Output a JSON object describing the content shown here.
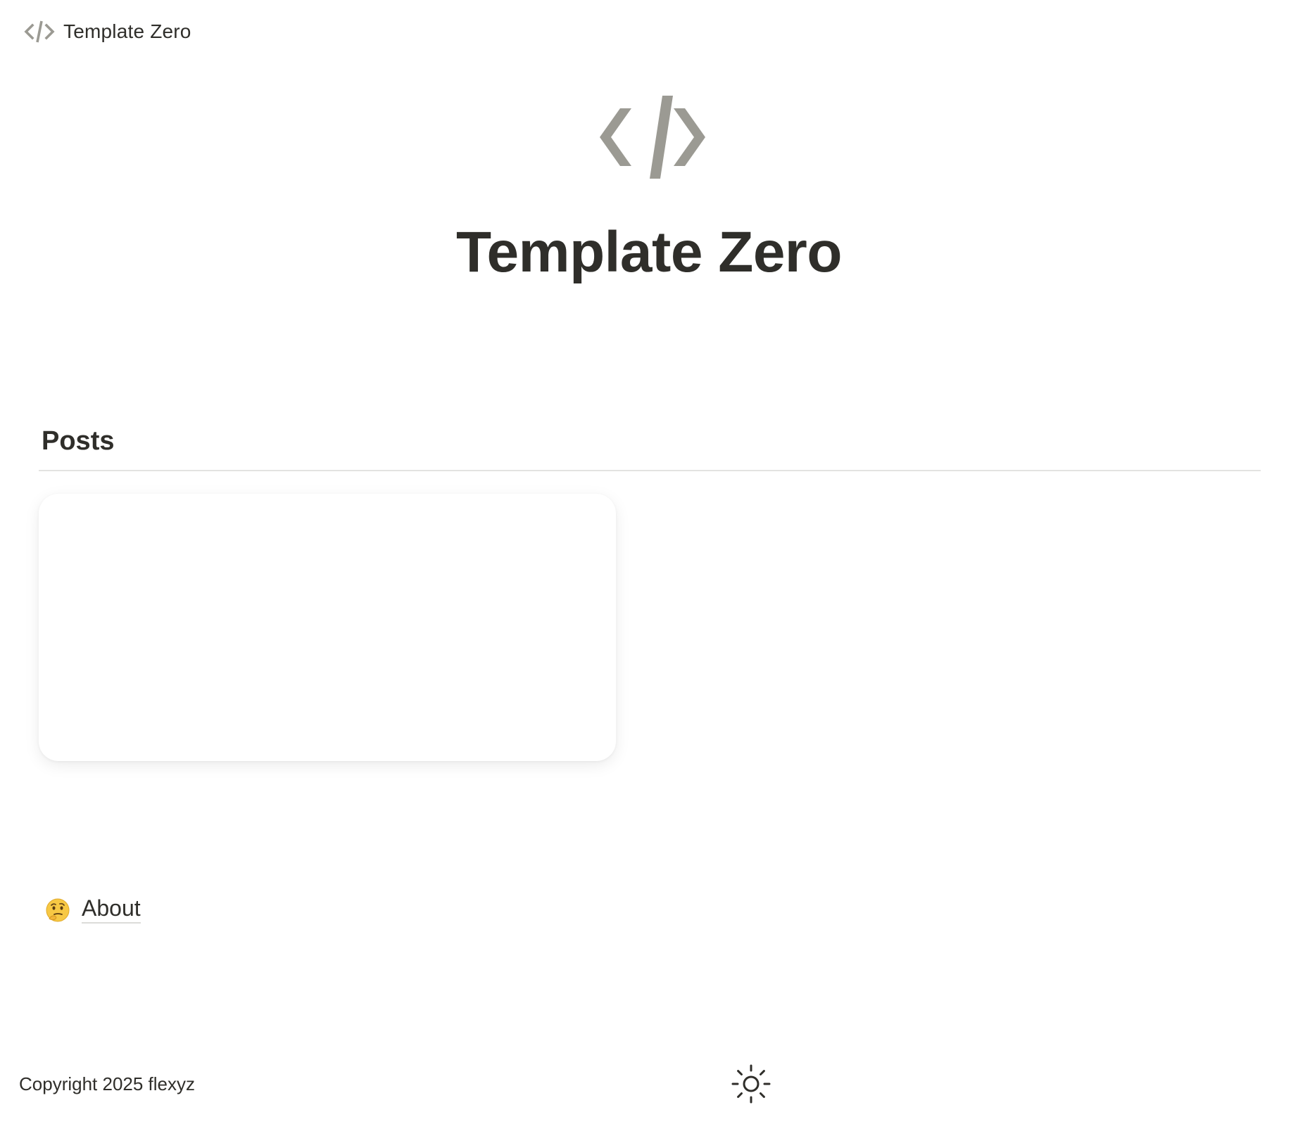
{
  "header": {
    "brand": "Template Zero",
    "logo_icon": "code-icon"
  },
  "hero": {
    "icon": "code-icon",
    "title": "Template Zero",
    "icon_color": "#9b9a93"
  },
  "posts": {
    "section_title": "Posts",
    "cards": [
      {
        "title": ""
      }
    ]
  },
  "about": {
    "emoji": "thinking-face-icon",
    "label": "About"
  },
  "footer": {
    "copyright": "Copyright 2025 flexyz",
    "theme_toggle_icon": "sun-icon"
  },
  "colors": {
    "text": "#2f2e2a",
    "muted_icon": "#9b9a93",
    "divider": "#e3e3e1",
    "background": "#ffffff"
  }
}
